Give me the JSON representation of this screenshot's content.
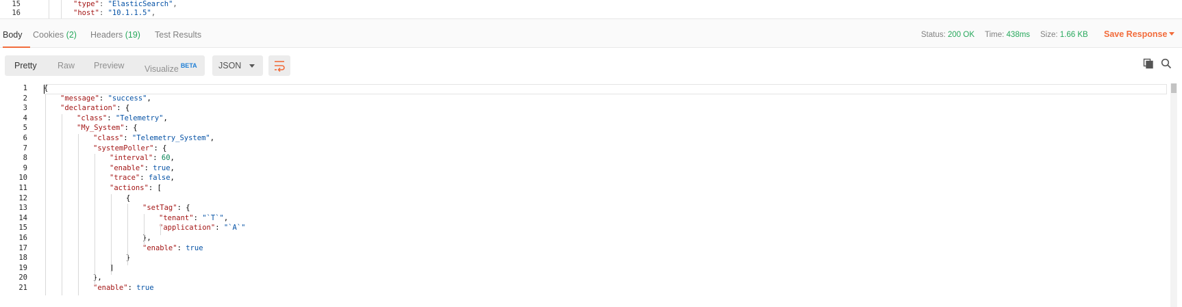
{
  "top_editor": {
    "lines": [
      {
        "num": "15",
        "key": "\"type\"",
        "value": "\"ElasticSearch\"",
        "trail": ","
      },
      {
        "num": "16",
        "key": "\"host\"",
        "value": "\"10.1.1.5\"",
        "trail": ","
      }
    ]
  },
  "response_tabs": [
    {
      "label": "Body",
      "count": ""
    },
    {
      "label": "Cookies",
      "count": "(2)"
    },
    {
      "label": "Headers",
      "count": "(19)"
    },
    {
      "label": "Test Results",
      "count": ""
    }
  ],
  "status": {
    "status_label": "Status:",
    "status_value": "200 OK",
    "time_label": "Time:",
    "time_value": "438ms",
    "size_label": "Size:",
    "size_value": "1.66 KB"
  },
  "save_response": "Save Response",
  "view_modes": [
    "Pretty",
    "Raw",
    "Preview",
    "Visualize"
  ],
  "beta_badge": "BETA",
  "format": "JSON",
  "icons": {
    "wrap": "wrap-lines-icon",
    "copy": "copy-icon",
    "search": "search-icon"
  },
  "colors": {
    "accent": "#f26b3a",
    "status_green": "#26a85b",
    "json_key": "#a31515",
    "json_string": "#0451a5",
    "json_number": "#098658"
  },
  "code_lines": [
    {
      "num": "1",
      "tokens": [
        {
          "t": "p",
          "v": "{"
        }
      ]
    },
    {
      "num": "2",
      "tokens": [
        {
          "t": "key",
          "v": "\"message\""
        },
        {
          "t": "p",
          "v": ": "
        },
        {
          "t": "str",
          "v": "\"success\""
        },
        {
          "t": "p",
          "v": ","
        }
      ]
    },
    {
      "num": "3",
      "tokens": [
        {
          "t": "key",
          "v": "\"declaration\""
        },
        {
          "t": "p",
          "v": ": {"
        }
      ]
    },
    {
      "num": "4",
      "tokens": [
        {
          "t": "key",
          "v": "\"class\""
        },
        {
          "t": "p",
          "v": ": "
        },
        {
          "t": "str",
          "v": "\"Telemetry\""
        },
        {
          "t": "p",
          "v": ","
        }
      ]
    },
    {
      "num": "5",
      "tokens": [
        {
          "t": "key",
          "v": "\"My_System\""
        },
        {
          "t": "p",
          "v": ": {"
        }
      ]
    },
    {
      "num": "6",
      "tokens": [
        {
          "t": "key",
          "v": "\"class\""
        },
        {
          "t": "p",
          "v": ": "
        },
        {
          "t": "str",
          "v": "\"Telemetry_System\""
        },
        {
          "t": "p",
          "v": ","
        }
      ]
    },
    {
      "num": "7",
      "tokens": [
        {
          "t": "key",
          "v": "\"systemPoller\""
        },
        {
          "t": "p",
          "v": ": {"
        }
      ]
    },
    {
      "num": "8",
      "tokens": [
        {
          "t": "key",
          "v": "\"interval\""
        },
        {
          "t": "p",
          "v": ": "
        },
        {
          "t": "num",
          "v": "60"
        },
        {
          "t": "p",
          "v": ","
        }
      ]
    },
    {
      "num": "9",
      "tokens": [
        {
          "t": "key",
          "v": "\"enable\""
        },
        {
          "t": "p",
          "v": ": "
        },
        {
          "t": "bool",
          "v": "true"
        },
        {
          "t": "p",
          "v": ","
        }
      ]
    },
    {
      "num": "10",
      "tokens": [
        {
          "t": "key",
          "v": "\"trace\""
        },
        {
          "t": "p",
          "v": ": "
        },
        {
          "t": "bool",
          "v": "false"
        },
        {
          "t": "p",
          "v": ","
        }
      ]
    },
    {
      "num": "11",
      "tokens": [
        {
          "t": "key",
          "v": "\"actions\""
        },
        {
          "t": "p",
          "v": ": ["
        }
      ]
    },
    {
      "num": "12",
      "tokens": [
        {
          "t": "p",
          "v": "{"
        }
      ]
    },
    {
      "num": "13",
      "tokens": [
        {
          "t": "key",
          "v": "\"setTag\""
        },
        {
          "t": "p",
          "v": ": {"
        }
      ]
    },
    {
      "num": "14",
      "tokens": [
        {
          "t": "key",
          "v": "\"tenant\""
        },
        {
          "t": "p",
          "v": ": "
        },
        {
          "t": "str",
          "v": "\"`T`\""
        },
        {
          "t": "p",
          "v": ","
        }
      ]
    },
    {
      "num": "15",
      "tokens": [
        {
          "t": "key",
          "v": "\"application\""
        },
        {
          "t": "p",
          "v": ": "
        },
        {
          "t": "str",
          "v": "\"`A`\""
        }
      ]
    },
    {
      "num": "16",
      "tokens": [
        {
          "t": "p",
          "v": "},"
        }
      ]
    },
    {
      "num": "17",
      "tokens": [
        {
          "t": "key",
          "v": "\"enable\""
        },
        {
          "t": "p",
          "v": ": "
        },
        {
          "t": "bool",
          "v": "true"
        }
      ]
    },
    {
      "num": "18",
      "tokens": [
        {
          "t": "p",
          "v": "}"
        }
      ]
    },
    {
      "num": "19",
      "tokens": [
        {
          "t": "p",
          "v": "]"
        }
      ]
    },
    {
      "num": "20",
      "tokens": [
        {
          "t": "p",
          "v": "},"
        }
      ]
    },
    {
      "num": "21",
      "tokens": [
        {
          "t": "key",
          "v": "\"enable\""
        },
        {
          "t": "p",
          "v": ": "
        },
        {
          "t": "bool",
          "v": "true"
        }
      ]
    }
  ]
}
